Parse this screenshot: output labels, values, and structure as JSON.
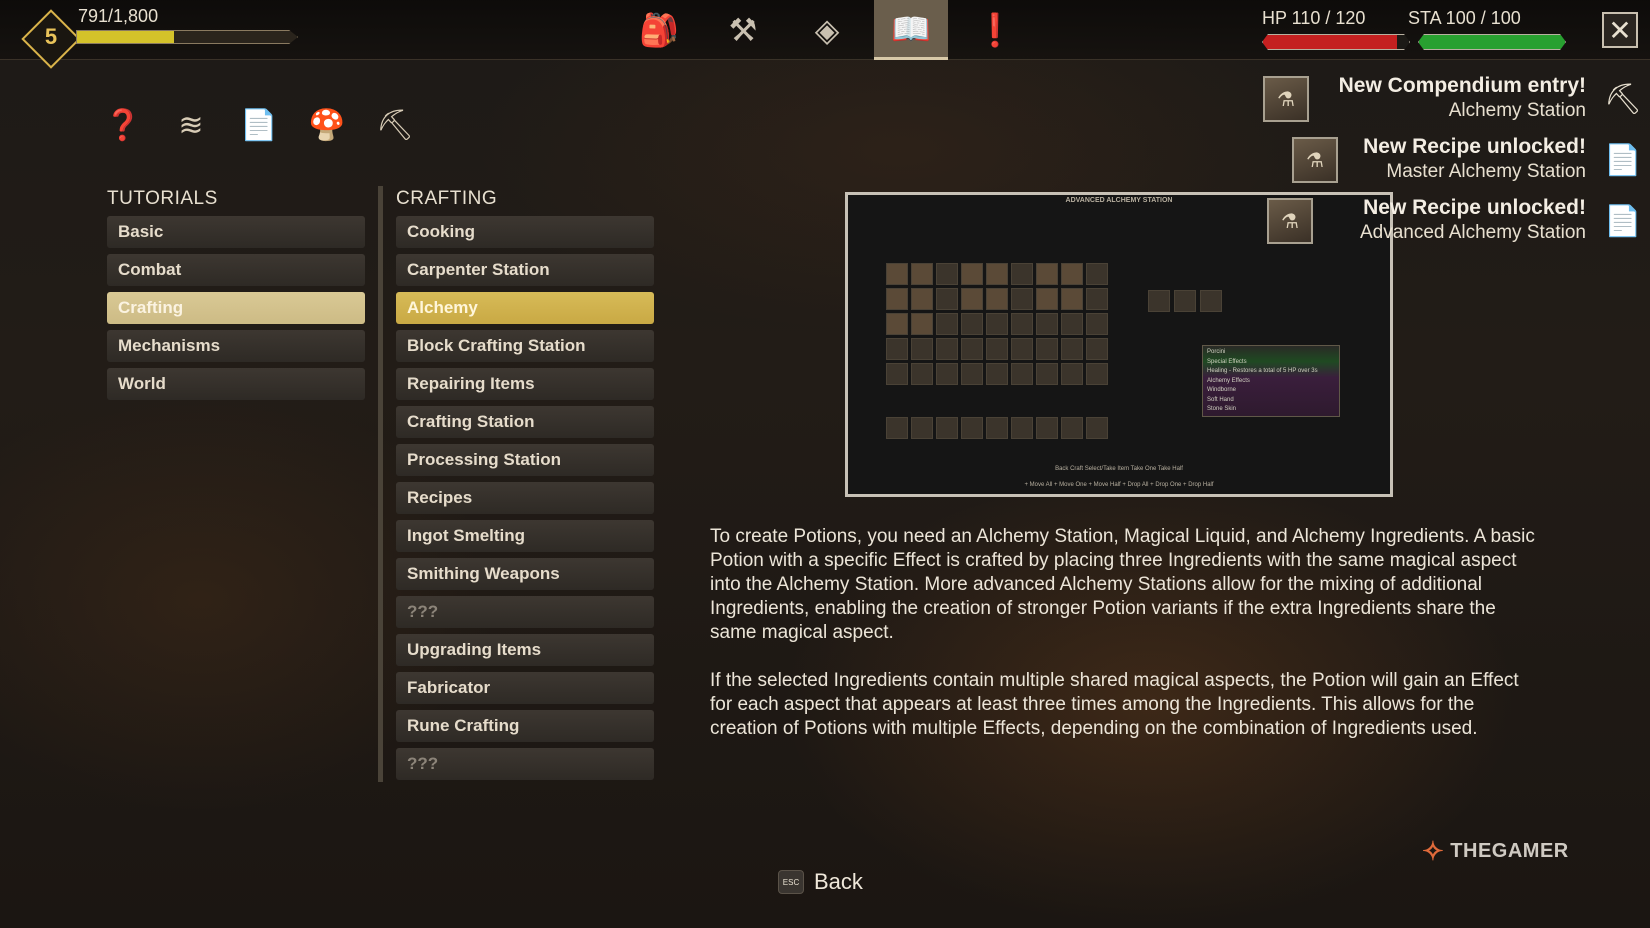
{
  "hud": {
    "level": "5",
    "xp_text": "791/1,800",
    "xp_fraction": 0.44,
    "hp_label": "HP 110 / 120",
    "hp_fraction": 0.917,
    "sta_label": "STA 100 / 100",
    "sta_fraction": 1.0,
    "close_symbol": "✕",
    "colors": {
      "xp": "#d4c22a",
      "hp": "#c42020",
      "sta": "#28a030"
    }
  },
  "top_tabs": [
    {
      "icon": "backpack-icon",
      "glyph": "🎒",
      "active": false
    },
    {
      "icon": "hammer-icon",
      "glyph": "⚒",
      "active": false
    },
    {
      "icon": "skill-diamond-icon",
      "glyph": "◈",
      "active": false
    },
    {
      "icon": "book-icon",
      "glyph": "📖",
      "active": true
    },
    {
      "icon": "exclamation-icon",
      "glyph": "❗",
      "active": false
    }
  ],
  "category_icons": [
    {
      "icon": "question-icon",
      "glyph": "❓"
    },
    {
      "icon": "claw-icon",
      "glyph": "≋"
    },
    {
      "icon": "document-icon",
      "glyph": "📄"
    },
    {
      "icon": "mushroom-icon",
      "glyph": "🍄"
    },
    {
      "icon": "pickaxe-icon",
      "glyph": "⛏"
    }
  ],
  "tutorials": {
    "title": "TUTORIALS",
    "items": [
      "Basic",
      "Combat",
      "Crafting",
      "Mechanisms",
      "World"
    ],
    "selected_index": 2
  },
  "crafting": {
    "title": "CRAFTING",
    "items": [
      "Cooking",
      "Carpenter Station",
      "Alchemy",
      "Block Crafting Station",
      "Repairing Items",
      "Crafting Station",
      "Processing Station",
      "Recipes",
      "Ingot Smelting",
      "Smithing Weapons",
      "???",
      "Upgrading Items",
      "Fabricator",
      "Rune Crafting",
      "???"
    ],
    "selected_index": 2
  },
  "preview": {
    "title": "ADVANCED ALCHEMY STATION",
    "tooltip_lines": [
      "Porcini",
      "Special Effects",
      "Healing - Restores a total of 5 HP over 3s",
      "Alchemy Effects",
      "Windborne",
      "Soft Hand",
      "Stone Skin"
    ],
    "controls_row1": "Back   Craft   Select/Take Item   Take One   Take Half",
    "controls_row2": "+ Move All   + Move One   + Move Half   + Drop All   + Drop One   + Drop Half"
  },
  "notifications": [
    {
      "title": "New Compendium entry!",
      "subtitle": "Alchemy Station",
      "icon": "pickaxe-icon",
      "glyph": "⛏"
    },
    {
      "title": "New Recipe unlocked!",
      "subtitle": "Master Alchemy Station",
      "icon": "document-icon",
      "glyph": "📄"
    },
    {
      "title": "New Recipe unlocked!",
      "subtitle": "Advanced Alchemy Station",
      "icon": "document-icon",
      "glyph": "📄"
    }
  ],
  "description": {
    "p1": "To create Potions, you need an Alchemy Station, Magical Liquid, and Alchemy Ingredients. A basic Potion with a specific Effect is crafted by placing three Ingredients with the same magical aspect into the Alchemy Station. More advanced Alchemy Stations allow for the mixing of additional Ingredients, enabling the creation of stronger Potion variants if the extra Ingredients share the same magical aspect.",
    "p2": "If the selected Ingredients contain multiple shared magical aspects, the Potion will gain an Effect for each aspect that appears at least three times among the Ingredients. This allows for the creation of Potions with multiple Effects, depending on the combination of Ingredients used."
  },
  "footer": {
    "esc_key": "ESC",
    "back_label": "Back",
    "watermark": "THEGAMER"
  }
}
